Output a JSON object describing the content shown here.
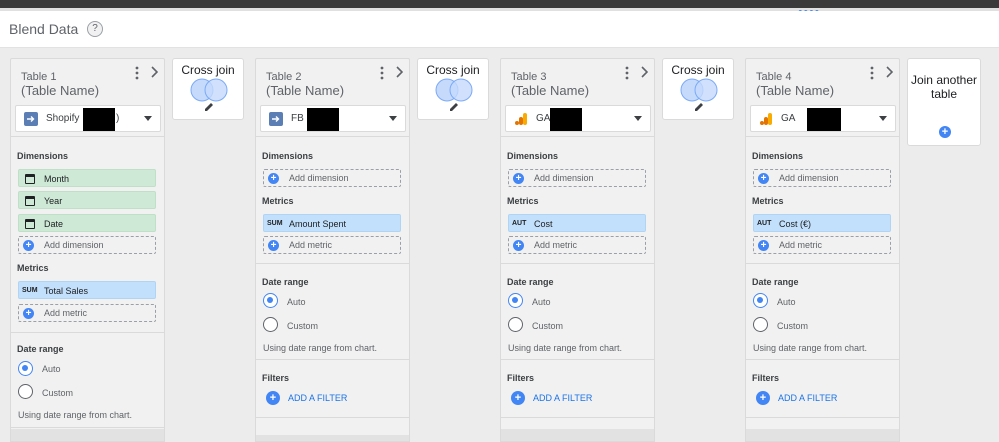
{
  "header": {
    "title": "Blend Data",
    "help_icon": "?"
  },
  "colors": {
    "accent": "#4285f4",
    "dimension_chip": "#ceead6",
    "metric_chip": "#c2e0fb",
    "link": "#1a73e8"
  },
  "cross_join": {
    "label": "Cross join",
    "icon": "venn-icon"
  },
  "join": {
    "label": "Join another table",
    "plus": "+"
  },
  "tables": [
    {
      "name": "Table 1",
      "subname": "(Table Name)",
      "source": {
        "label": "Shopify",
        "trail": ")",
        "icon": "connector-icon"
      },
      "dimensions_label": "Dimensions",
      "dimensions": [
        {
          "label": "Month"
        },
        {
          "label": "Year"
        },
        {
          "label": "Date"
        }
      ],
      "add_dimension": "Add dimension",
      "metrics_label": "Metrics",
      "metrics": [
        {
          "agg": "SUM",
          "label": "Total Sales"
        }
      ],
      "add_metric": "Add metric",
      "date_range_label": "Date range",
      "auto": "Auto",
      "custom": "Custom",
      "note": "Using date range from chart."
    },
    {
      "name": "Table 2",
      "subname": "(Table Name)",
      "source": {
        "label": "FB",
        "icon": "connector-icon"
      },
      "dimensions_label": "Dimensions",
      "add_dimension": "Add dimension",
      "metrics_label": "Metrics",
      "metrics": [
        {
          "agg": "SUM",
          "label": "Amount Spent"
        }
      ],
      "add_metric": "Add metric",
      "date_range_label": "Date range",
      "auto": "Auto",
      "custom": "Custom",
      "note": "Using date range from chart.",
      "filters_label": "Filters",
      "add_filter": "ADD A FILTER"
    },
    {
      "name": "Table 3",
      "subname": "(Table Name)",
      "source": {
        "label": "GA",
        "icon": "google-analytics-icon"
      },
      "dimensions_label": "Dimensions",
      "add_dimension": "Add dimension",
      "metrics_label": "Metrics",
      "metrics": [
        {
          "agg": "AUT",
          "label": "Cost"
        }
      ],
      "add_metric": "Add metric",
      "date_range_label": "Date range",
      "auto": "Auto",
      "custom": "Custom",
      "note": "Using date range from chart.",
      "filters_label": "Filters",
      "add_filter": "ADD A FILTER"
    },
    {
      "name": "Table 4",
      "subname": "(Table Name)",
      "source": {
        "label": "GA",
        "icon": "google-analytics-icon"
      },
      "dimensions_label": "Dimensions",
      "add_dimension": "Add dimension",
      "metrics_label": "Metrics",
      "metrics": [
        {
          "agg": "AUT",
          "label": "Cost (€)"
        }
      ],
      "add_metric": "Add metric",
      "date_range_label": "Date range",
      "auto": "Auto",
      "custom": "Custom",
      "note": "Using date range from chart.",
      "filters_label": "Filters",
      "add_filter": "ADD A FILTER"
    }
  ]
}
